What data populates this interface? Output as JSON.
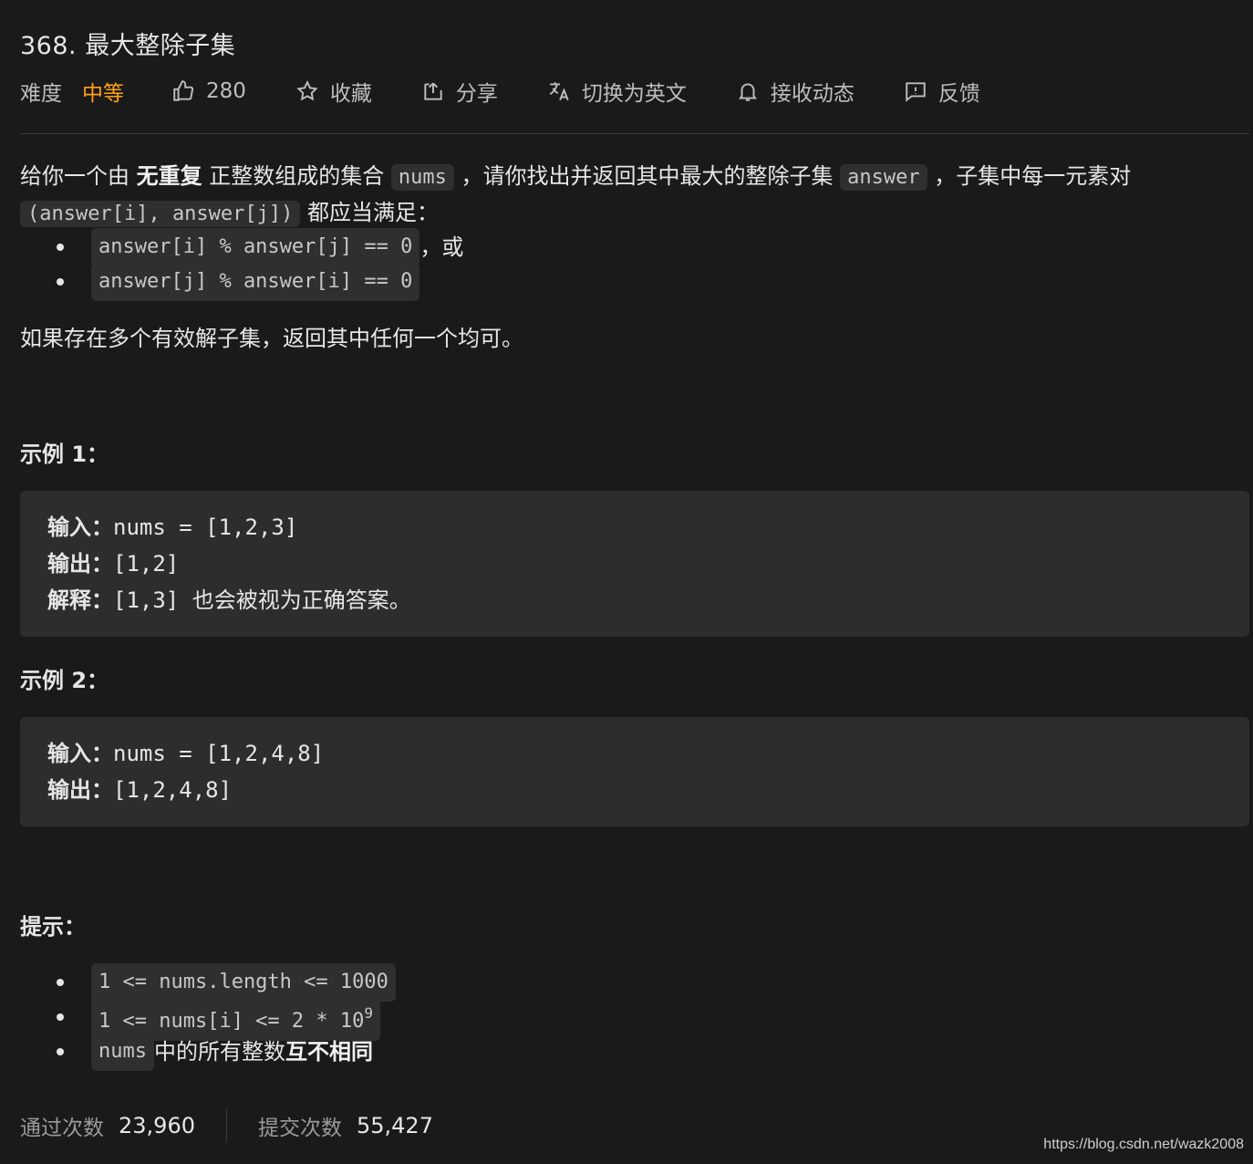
{
  "problem": {
    "title": "368. 最大整除子集"
  },
  "toolbar": {
    "difficulty_label": "难度",
    "difficulty_value": "中等",
    "likes": "280",
    "favorite": "收藏",
    "share": "分享",
    "switch_lang": "切换为英文",
    "subscribe": "接收动态",
    "feedback": "反馈"
  },
  "description": {
    "p1_a": "给你一个由 ",
    "p1_bold": "无重复",
    "p1_b": " 正整数组成的集合 ",
    "p1_code1": "nums",
    "p1_c": " ，请你找出并返回其中最大的整除子集 ",
    "p1_code2": "answer",
    "p1_d": " ，子集中每一元素对",
    "p1_code3": "(answer[i], answer[j])",
    "p1_e": " 都应当满足：",
    "cond1_code": "answer[i] % answer[j] == 0",
    "cond1_tail": " ，或",
    "cond2_code": "answer[j] % answer[i] == 0",
    "p2": "如果存在多个有效解子集，返回其中任何一个均可。"
  },
  "examples": [
    {
      "heading": "示例 1：",
      "input_label": "输入：",
      "input": "nums = [1,2,3]",
      "output_label": "输出：",
      "output": "[1,2]",
      "explain_label": "解释：",
      "explain": "[1,3] 也会被视为正确答案。"
    },
    {
      "heading": "示例 2：",
      "input_label": "输入：",
      "input": "nums = [1,2,4,8]",
      "output_label": "输出：",
      "output": "[1,2,4,8]"
    }
  ],
  "constraints": {
    "heading": "提示：",
    "c1": "1 <= nums.length <= 1000",
    "c2_main": "1 <= nums[i] <= 2 * 10",
    "c2_sup": "9",
    "c3_code": "nums",
    "c3_text": " 中的所有整数 ",
    "c3_bold": "互不相同"
  },
  "stats": {
    "accepted_label": "通过次数",
    "accepted": "23,960",
    "submissions_label": "提交次数",
    "submissions": "55,427"
  },
  "watermark": "https://blog.csdn.net/wazk2008"
}
